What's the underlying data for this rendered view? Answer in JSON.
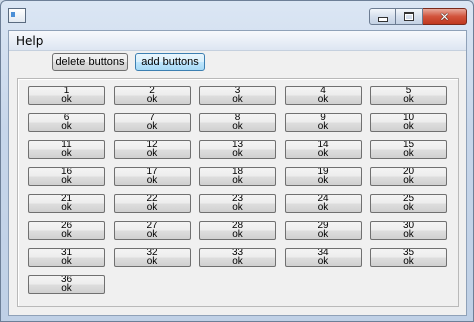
{
  "menu": {
    "help": "Help"
  },
  "toolbar": {
    "delete_label": "delete buttons",
    "add_label": "add buttons"
  },
  "grid": {
    "columns": 5,
    "buttons": [
      {
        "num": "1",
        "sub": "ok"
      },
      {
        "num": "2",
        "sub": "ok"
      },
      {
        "num": "3",
        "sub": "ok"
      },
      {
        "num": "4",
        "sub": "ok"
      },
      {
        "num": "5",
        "sub": "ok"
      },
      {
        "num": "6",
        "sub": "ok"
      },
      {
        "num": "7",
        "sub": "ok"
      },
      {
        "num": "8",
        "sub": "ok"
      },
      {
        "num": "9",
        "sub": "ok"
      },
      {
        "num": "10",
        "sub": "ok"
      },
      {
        "num": "11",
        "sub": "ok"
      },
      {
        "num": "12",
        "sub": "ok"
      },
      {
        "num": "13",
        "sub": "ok"
      },
      {
        "num": "14",
        "sub": "ok"
      },
      {
        "num": "15",
        "sub": "ok"
      },
      {
        "num": "16",
        "sub": "ok"
      },
      {
        "num": "17",
        "sub": "ok"
      },
      {
        "num": "18",
        "sub": "ok"
      },
      {
        "num": "19",
        "sub": "ok"
      },
      {
        "num": "20",
        "sub": "ok"
      },
      {
        "num": "21",
        "sub": "ok"
      },
      {
        "num": "22",
        "sub": "ok"
      },
      {
        "num": "23",
        "sub": "ok"
      },
      {
        "num": "24",
        "sub": "ok"
      },
      {
        "num": "25",
        "sub": "ok"
      },
      {
        "num": "26",
        "sub": "ok"
      },
      {
        "num": "27",
        "sub": "ok"
      },
      {
        "num": "28",
        "sub": "ok"
      },
      {
        "num": "29",
        "sub": "ok"
      },
      {
        "num": "30",
        "sub": "ok"
      },
      {
        "num": "31",
        "sub": "ok"
      },
      {
        "num": "32",
        "sub": "ok"
      },
      {
        "num": "33",
        "sub": "ok"
      },
      {
        "num": "34",
        "sub": "ok"
      },
      {
        "num": "35",
        "sub": "ok"
      },
      {
        "num": "36",
        "sub": "ok"
      }
    ]
  },
  "window_controls": {
    "close_glyph": "✕"
  },
  "icons": [
    "app-icon",
    "minimize-icon",
    "maximize-icon",
    "close-icon"
  ]
}
